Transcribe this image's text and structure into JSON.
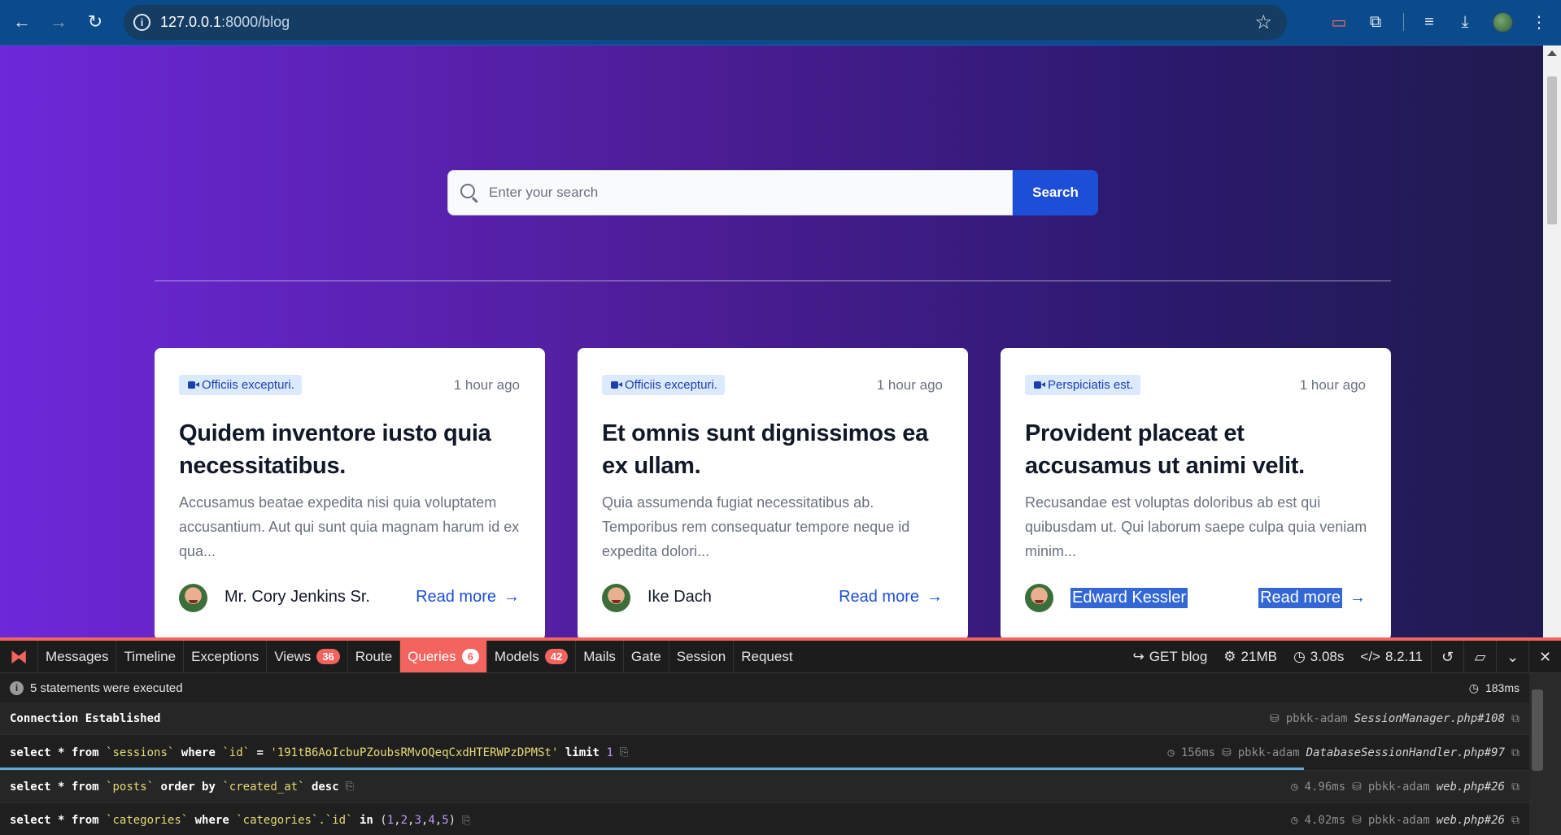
{
  "browser": {
    "url_host": "127.0.0.1",
    "url_port_path": ":8000/blog"
  },
  "search": {
    "placeholder": "Enter your search",
    "button_label": "Search"
  },
  "posts": [
    {
      "category": "Officiis excepturi.",
      "time": "1 hour ago",
      "title": "Quidem inventore iusto quia necessitatibus.",
      "excerpt": "Accusamus beatae expedita nisi quia voluptatem accusantium. Aut qui sunt quia magnam harum id ex qua...",
      "author": "Mr. Cory Jenkins Sr.",
      "read_more": "Read more"
    },
    {
      "category": "Officiis excepturi.",
      "time": "1 hour ago",
      "title": "Et omnis sunt dignissimos ea ex ullam.",
      "excerpt": "Quia assumenda fugiat necessitatibus ab. Temporibus rem consequatur tempore neque id expedita dolori...",
      "author": "Ike Dach",
      "read_more": "Read more"
    },
    {
      "category": "Perspiciatis est.",
      "time": "1 hour ago",
      "title": "Provident placeat et accusamus ut animi velit.",
      "excerpt": "Recusandae est voluptas doloribus ab est qui quibusdam ut. Qui laborum saepe culpa quia veniam minim...",
      "author": "Edward Kessler",
      "read_more": "Read more"
    }
  ],
  "debugbar": {
    "tabs": [
      {
        "label": "Messages"
      },
      {
        "label": "Timeline"
      },
      {
        "label": "Exceptions"
      },
      {
        "label": "Views",
        "badge": "36"
      },
      {
        "label": "Route"
      },
      {
        "label": "Queries",
        "badge": "6"
      },
      {
        "label": "Models",
        "badge": "42"
      },
      {
        "label": "Mails"
      },
      {
        "label": "Gate"
      },
      {
        "label": "Session"
      },
      {
        "label": "Request"
      }
    ],
    "request": "GET blog",
    "memory": "21MB",
    "time": "3.08s",
    "php_version": "8.2.11",
    "summary": "5 statements were executed",
    "summary_time": "183ms",
    "connection": "Connection Established",
    "connection_db": "pbkk-adam",
    "connection_file": "SessionManager.php#108",
    "statements": [
      {
        "duration": "156ms",
        "db": "pbkk-adam",
        "file": "DatabaseSessionHandler.php#97"
      },
      {
        "duration": "4.96ms",
        "db": "pbkk-adam",
        "file": "web.php#26"
      },
      {
        "duration": "4.02ms",
        "db": "pbkk-adam",
        "file": "web.php#26"
      }
    ],
    "sql": {
      "select": "select",
      "star_from": "* from",
      "where": "where",
      "limit": "limit",
      "order_by": "order by",
      "desc": "desc",
      "in": "in",
      "t_sessions": "`sessions`",
      "c_id": "`id`",
      "eq": "=",
      "session_val": "'191tB6AoIcbuPZoubsRMvOQeqCxdHTERWPzDPMSt'",
      "limit_val": "1",
      "t_posts": "`posts`",
      "c_created_at": "`created_at`",
      "t_categories": "`categories`",
      "c_categories_id": "`categories`.`id`",
      "open": "(",
      "n1": "1",
      "n2": "2",
      "n3": "3",
      "n4": "4",
      "n5": "5",
      "comma": ", ",
      "close": ")"
    }
  }
}
